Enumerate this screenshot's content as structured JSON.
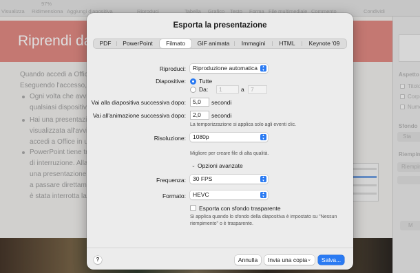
{
  "app": {
    "toolbar": [
      "Visualizza",
      "Ridimensiona",
      "Aggiungi diapositiva",
      "Riproduci",
      "Tabella",
      "Grafico",
      "Testo",
      "Forma",
      "File multimediale",
      "Commento",
      "Condividi"
    ],
    "zoom": "97%"
  },
  "slide": {
    "title": "Riprendi da",
    "lines": [
      "Quando accedi a Office",
      "Eseguendo l'accesso, l",
      "Ogni volta che avvii",
      "qualsiasi dispositivo",
      "Hai una presentazion",
      "visualizzata all'avvio",
      "accedi a Office in u",
      "PowerPoint tiene tra",
      "di interruzione. Alla",
      "una presentazione,",
      "a passare direttame",
      "è stata interrotta la"
    ]
  },
  "sidebar": {
    "aspect_label": "Aspetto",
    "items": [
      "Titolo",
      "Corpo",
      "Numero"
    ],
    "background_label": "Sfondo",
    "background_btn": "Sta",
    "fill_label": "Riempim",
    "fill_btn": "Riempim",
    "bottom_btn": "M"
  },
  "dialog": {
    "title": "Esporta la presentazione",
    "tabs": [
      "PDF",
      "PowerPoint",
      "Filmato",
      "GIF animata",
      "Immagini",
      "HTML",
      "Keynote '09"
    ],
    "active_tab": "Filmato",
    "play_label": "Riproduci:",
    "play_value": "Riproduzione automatica",
    "slides_label": "Diapositive:",
    "all_label": "Tutte",
    "from_label": "Da:",
    "from_value": "1",
    "to_label": "a",
    "to_value": "7",
    "next_slide_label": "Vai alla diapositiva successiva dopo:",
    "next_slide_value": "5,0",
    "next_anim_label": "Vai all'animazione successiva dopo:",
    "next_anim_value": "2,0",
    "seconds": "secondi",
    "timing_note": "La temporizzazione si applica solo agli eventi clic.",
    "resolution_label": "Risoluzione:",
    "resolution_value": "1080p",
    "resolution_note": "Migliore per creare file di alta qualità.",
    "advanced_label": "Opzioni avanzate",
    "frequency_label": "Frequenza:",
    "frequency_value": "30 FPS",
    "format_label": "Formato:",
    "format_value": "HEVC",
    "transparent_label": "Esporta con sfondo trasparente",
    "transparent_note_1": "Si applica quando lo sfondo della diapositiva è impostato su \"Nessun",
    "transparent_note_2": "riempimento\" o è trasparente.",
    "help": "?",
    "cancel": "Annulla",
    "send_copy": "Invia una copia",
    "save": "Salva..."
  },
  "colors": {
    "accent": "#2a7af2",
    "banner": "#e0837c"
  }
}
